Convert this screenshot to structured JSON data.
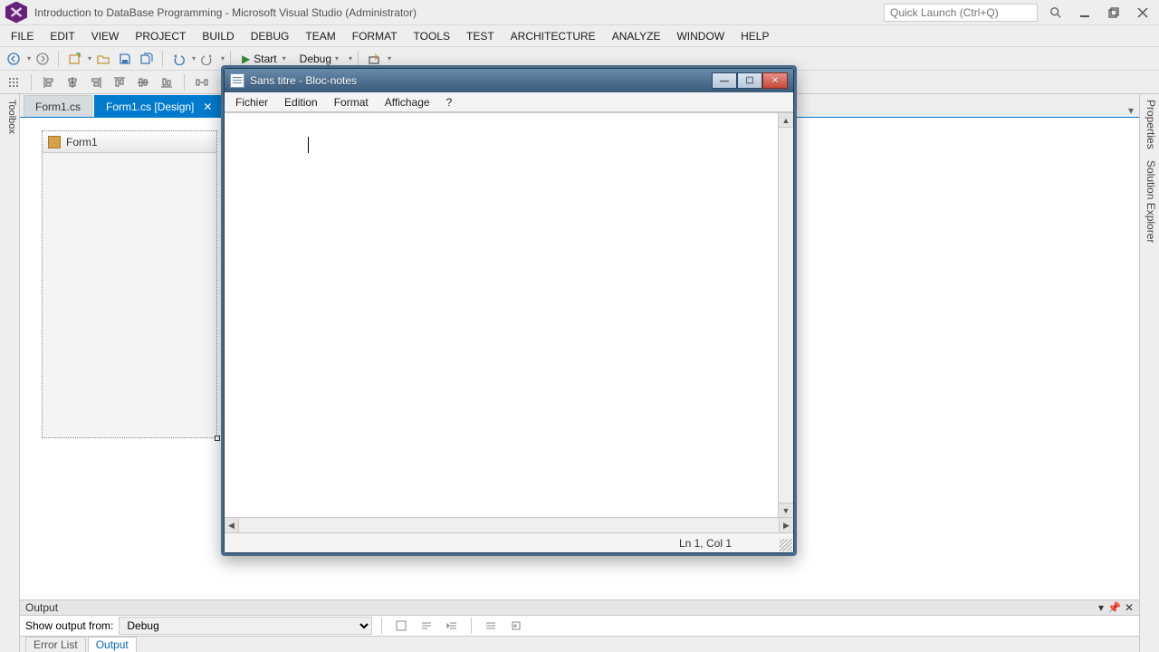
{
  "titlebar": {
    "title": "Introduction to DataBase Programming - Microsoft Visual Studio (Administrator)"
  },
  "quicklaunch": {
    "placeholder": "Quick Launch (Ctrl+Q)"
  },
  "menu": {
    "items": [
      "FILE",
      "EDIT",
      "VIEW",
      "PROJECT",
      "BUILD",
      "DEBUG",
      "TEAM",
      "FORMAT",
      "TOOLS",
      "TEST",
      "ARCHITECTURE",
      "ANALYZE",
      "WINDOW",
      "HELP"
    ]
  },
  "toolbar": {
    "start": "Start",
    "config": "Debug"
  },
  "tabs": {
    "t0": "Form1.cs",
    "t1": "Form1.cs [Design]"
  },
  "designer": {
    "form_title": "Form1"
  },
  "sidetabs": {
    "left": "Toolbox",
    "r0": "Properties",
    "r1": "Solution Explorer"
  },
  "output": {
    "title": "Output",
    "show_from": "Show output from:",
    "source": "Debug",
    "tabs": {
      "t0": "Error List",
      "t1": "Output"
    }
  },
  "notepad": {
    "title": "Sans titre - Bloc-notes",
    "menu": {
      "m0": "Fichier",
      "m1": "Edition",
      "m2": "Format",
      "m3": "Affichage",
      "m4": "?"
    },
    "status": "Ln 1, Col 1"
  }
}
